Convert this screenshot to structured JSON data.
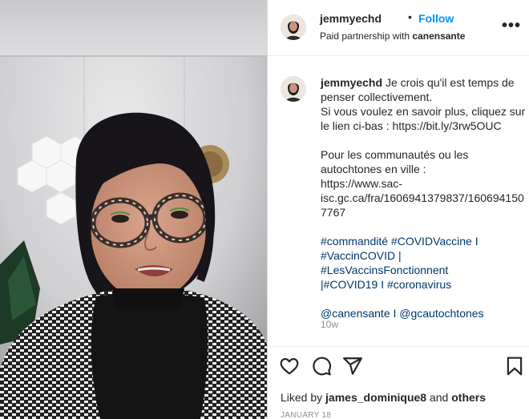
{
  "header": {
    "username": "jemmyechd",
    "separator": "•",
    "follow_label": "Follow",
    "subtitle_prefix": "Paid partnership with",
    "partner": "canensante",
    "more_label": "•••"
  },
  "caption": {
    "username": "jemmyechd",
    "lines": [
      "Je crois qu'il est temps de",
      "penser collectivement.",
      "Si vous voulez en savoir plus, cliquez sur",
      "le lien ci-bas : https://bit.ly/3rw5OUC",
      "",
      "Pour les communautés ou les",
      "autochtones en ville :",
      "https://www.sac-",
      "isc.gc.ca/fra/1606941379837/160694150",
      "7767",
      "",
      "#commandité #COVIDVaccine I",
      "#VaccinCOVID | #LesVaccinsFonctionnent",
      "|#COVID19 I #coronavirus",
      "",
      "@canensante I @gcautochtones"
    ],
    "time": "10w"
  },
  "likes": {
    "prefix": "Liked by",
    "user": "james_dominique8",
    "middle": "and",
    "others": "others"
  },
  "date": "JANUARY 18",
  "icons": {
    "like": "heart-icon",
    "comment": "comment-icon",
    "share": "share-icon",
    "save": "bookmark-icon",
    "more": "more-icon"
  },
  "colors": {
    "follow": "#0095f6",
    "text": "#262626",
    "muted": "#8e8e8e",
    "link": "#00376b"
  }
}
